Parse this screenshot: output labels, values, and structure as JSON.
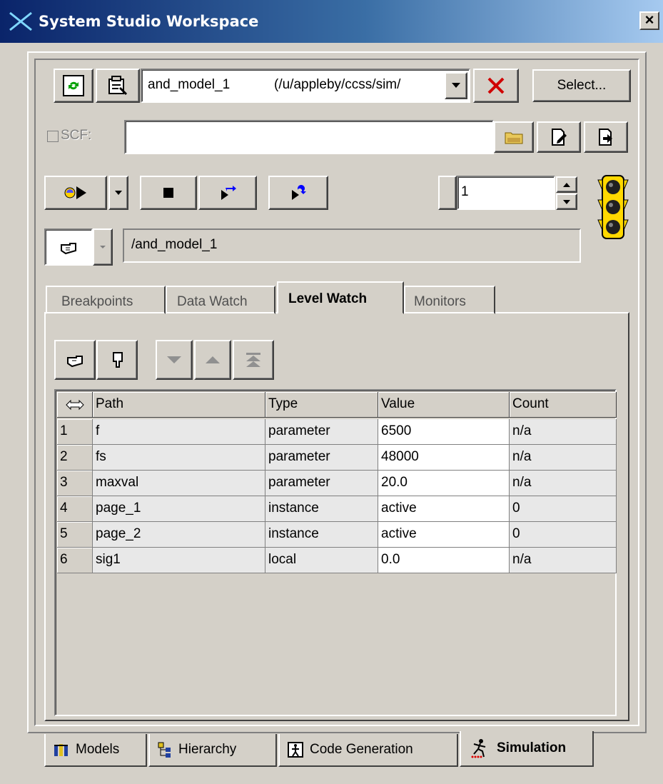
{
  "window": {
    "title": "System Studio Workspace",
    "close": "×"
  },
  "toolbar": {
    "model_name": "and_model_1",
    "model_path": "(/u/appleby/ccss/sim/",
    "select_label": "Select...",
    "scf_label": "SCF:",
    "scf_value": "",
    "step_value": "1"
  },
  "sim": {
    "path": "/and_model_1"
  },
  "tabs": [
    {
      "label": "Breakpoints",
      "active": false
    },
    {
      "label": "Data Watch",
      "active": false
    },
    {
      "label": "Level Watch",
      "active": true
    },
    {
      "label": "Monitors",
      "active": false
    }
  ],
  "table": {
    "columns": [
      "Path",
      "Type",
      "Value",
      "Count"
    ],
    "rows": [
      {
        "num": "1",
        "path": "f",
        "type": "parameter",
        "value": "6500",
        "count": "n/a"
      },
      {
        "num": "2",
        "path": "fs",
        "type": "parameter",
        "value": "48000",
        "count": "n/a"
      },
      {
        "num": "3",
        "path": "maxval",
        "type": "parameter",
        "value": "20.0",
        "count": "n/a"
      },
      {
        "num": "4",
        "path": "page_1",
        "type": "instance",
        "value": "active",
        "count": "0"
      },
      {
        "num": "5",
        "path": "page_2",
        "type": "instance",
        "value": "active",
        "count": "0"
      },
      {
        "num": "6",
        "path": "sig1",
        "type": "local",
        "value": "0.0",
        "count": "n/a"
      }
    ]
  },
  "bottom_tabs": [
    {
      "label": "Models",
      "active": false
    },
    {
      "label": "Hierarchy",
      "active": false
    },
    {
      "label": "Code Generation",
      "active": false
    },
    {
      "label": "Simulation",
      "active": true
    }
  ]
}
